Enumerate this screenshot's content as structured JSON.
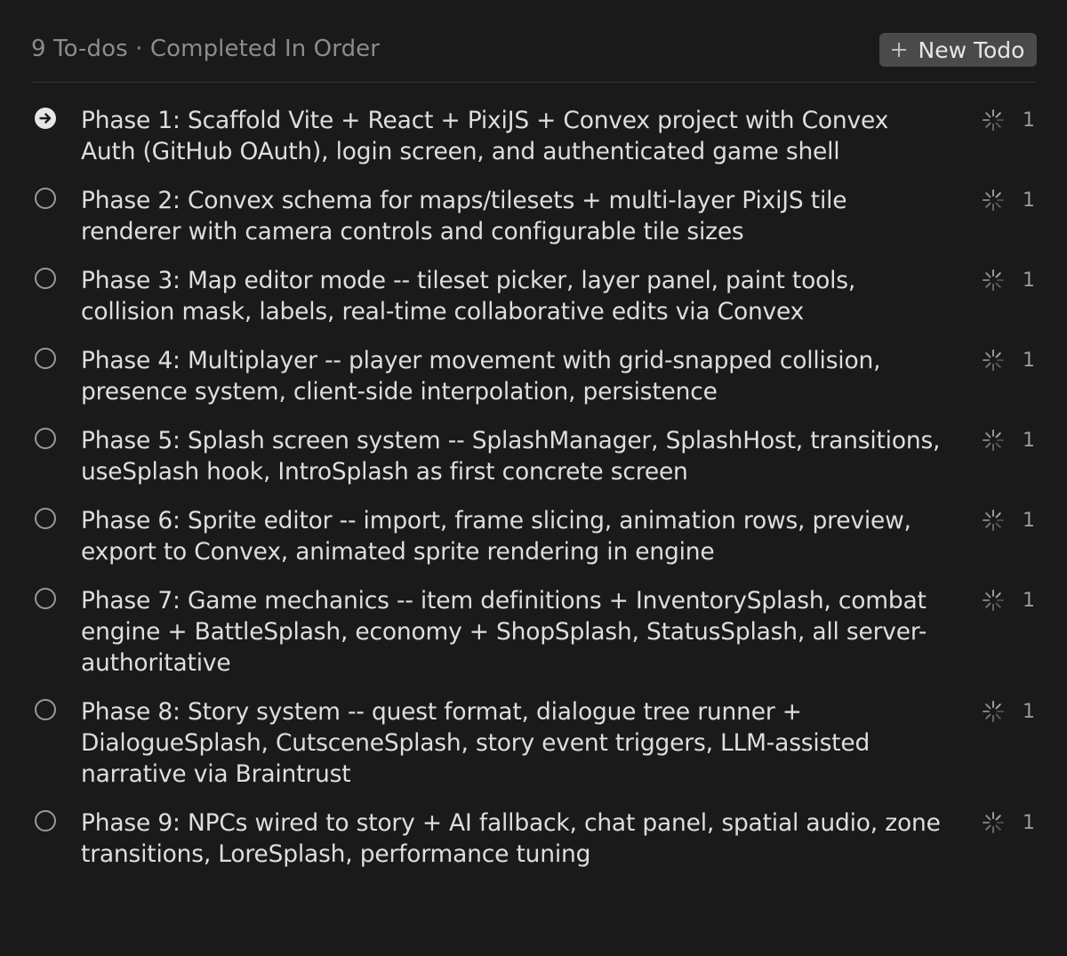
{
  "header": {
    "title": "9 To-dos · Completed In Order",
    "new_todo_label": "New Todo"
  },
  "todos": [
    {
      "text": "Phase 1: Scaffold Vite + React + PixiJS + Convex project with Convex Auth (GitHub OAuth), login screen, and authenticated game shell",
      "count": "1",
      "status": "in-progress"
    },
    {
      "text": "Phase 2: Convex schema for maps/tilesets + multi-layer PixiJS tile renderer with camera controls and configurable tile sizes",
      "count": "1",
      "status": "pending"
    },
    {
      "text": "Phase 3: Map editor mode -- tileset picker, layer panel, paint tools, collision mask, labels, real-time collaborative edits via Convex",
      "count": "1",
      "status": "pending"
    },
    {
      "text": "Phase 4: Multiplayer -- player movement with grid-snapped collision, presence system, client-side interpolation, persistence",
      "count": "1",
      "status": "pending"
    },
    {
      "text": "Phase 5: Splash screen system -- SplashManager, SplashHost, transitions, useSplash hook, IntroSplash as first concrete screen",
      "count": "1",
      "status": "pending"
    },
    {
      "text": "Phase 6: Sprite editor -- import, frame slicing, animation rows, preview, export to Convex, animated sprite rendering in engine",
      "count": "1",
      "status": "pending"
    },
    {
      "text": "Phase 7: Game mechanics -- item definitions + InventorySplash, combat engine + BattleSplash, economy + ShopSplash, StatusSplash, all server-authoritative",
      "count": "1",
      "status": "pending"
    },
    {
      "text": "Phase 8: Story system -- quest format, dialogue tree runner + DialogueSplash, CutsceneSplash, story event triggers, LLM-assisted narrative via Braintrust",
      "count": "1",
      "status": "pending"
    },
    {
      "text": "Phase 9: NPCs wired to story + AI fallback, chat panel, spatial audio, zone transitions, LoreSplash, performance tuning",
      "count": "1",
      "status": "pending"
    }
  ],
  "colors": {
    "background": "#1a1a1a",
    "button": "#4a4a4a",
    "text": "#dedede",
    "muted": "#8c8c8c"
  },
  "icons": {
    "active": "arrow-right-circle-icon",
    "pending": "empty-circle-icon",
    "loader": "loader-spinner-icon",
    "add": "plus-icon"
  }
}
